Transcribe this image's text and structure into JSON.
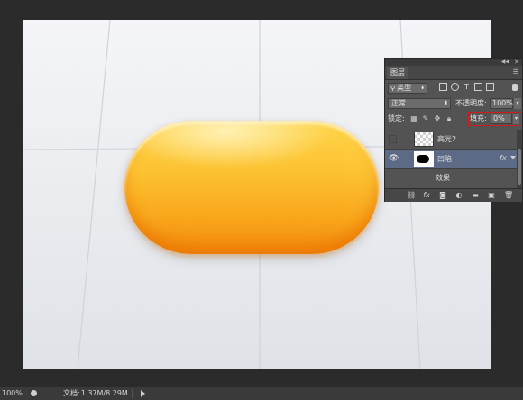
{
  "status_bar": {
    "zoom": "100%",
    "doc_label": "文档:",
    "doc_size": "1.37M/8.29M"
  },
  "layers_panel": {
    "tab": "图层",
    "filter_kind": "类型",
    "blend_mode": "正常",
    "opacity_label": "不透明度:",
    "opacity_value": "100%",
    "lock_label": "锁定:",
    "fill_label": "填充:",
    "fill_value": "0%",
    "layers": [
      {
        "name": "高光2",
        "visible": false,
        "selected": false,
        "thumbnail": "transparent"
      },
      {
        "name": "凹陷",
        "visible": true,
        "selected": true,
        "thumbnail": "shape",
        "has_fx": true,
        "fx": "fx"
      }
    ],
    "effect_label": "效果",
    "footer_icons": [
      "link-icon",
      "fx-icon",
      "mask-icon",
      "adjustment-icon",
      "folder-icon",
      "new-layer-icon",
      "trash-icon"
    ]
  },
  "colors": {
    "pill_top": "#ffd54a",
    "pill_bottom": "#f38a0c",
    "selection": "#5d6a86",
    "highlight_box": "#d11a1a"
  }
}
